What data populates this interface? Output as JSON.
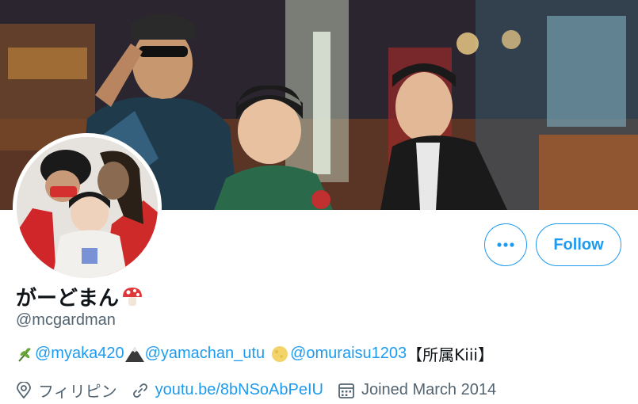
{
  "profile": {
    "display_name": "がーどまん",
    "handle": "@mcgardman",
    "bio": {
      "mentions": [
        "@myaka420",
        "@yamachan_utu",
        "@omuraisu1203"
      ],
      "tail": "【所属Kiii】"
    },
    "location": "フィリピン",
    "website": "youtu.be/8bNSoAbPeIU",
    "joined": "Joined March 2014"
  },
  "actions": {
    "follow_label": "Follow",
    "more_label": "•••"
  },
  "colors": {
    "accent": "#1d9bf0",
    "secondary_text": "#536471",
    "primary_text": "#0f1419"
  },
  "icons": [
    "mushroom-emoji",
    "herb-emoji",
    "mountain-emoji",
    "moon-emoji",
    "location-icon",
    "link-icon",
    "calendar-icon",
    "more-icon"
  ]
}
